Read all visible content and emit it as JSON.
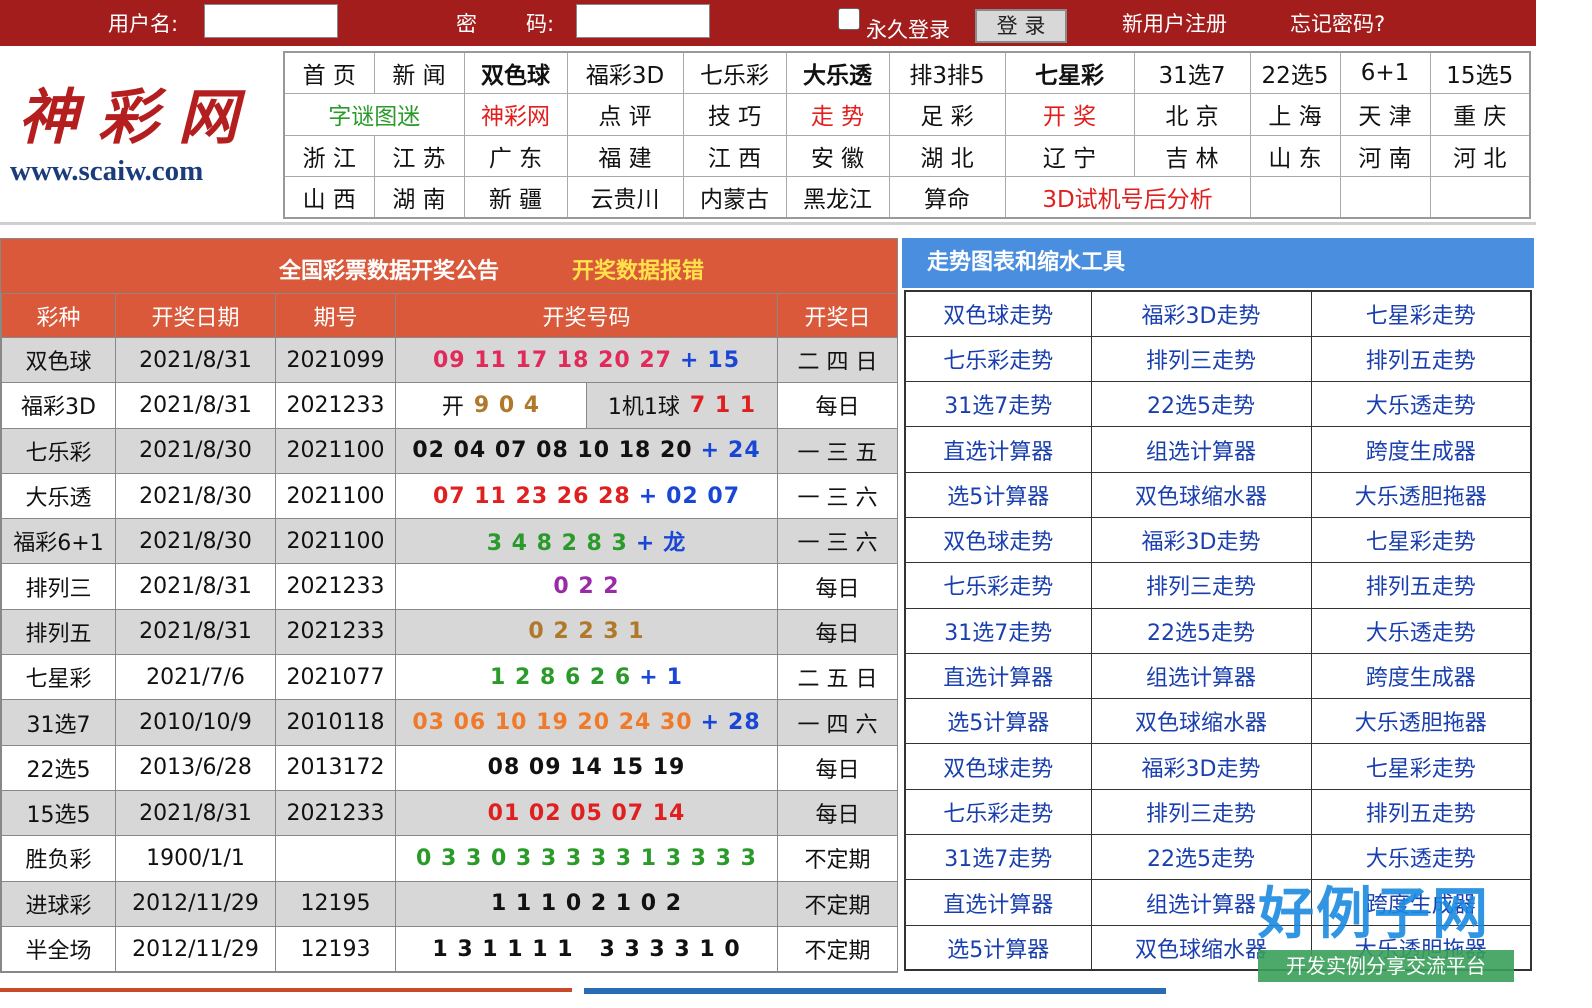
{
  "login": {
    "username_label": "用户名:",
    "password_label_1": "密",
    "password_label_2": "码:",
    "remember_label": "永久登录",
    "login_button": "登 录",
    "register_link": "新用户注册",
    "forgot_link": "忘记密码?"
  },
  "logo": {
    "name": "神彩网",
    "url": "www.scaiw.com"
  },
  "nav": [
    [
      {
        "t": "首 页"
      },
      {
        "t": "新 闻"
      },
      {
        "t": "双色球",
        "s": "b"
      },
      {
        "t": "福彩3D"
      },
      {
        "t": "七乐彩"
      },
      {
        "t": "大乐透",
        "s": "b"
      },
      {
        "t": "排3排5"
      },
      {
        "t": "七星彩",
        "s": "b"
      },
      {
        "t": "31选7"
      },
      {
        "t": "22选5"
      },
      {
        "t": "6+1"
      },
      {
        "t": "15选5"
      }
    ],
    [
      {
        "t": "字谜图迷",
        "s": "g",
        "c": 2
      },
      {
        "t": "神彩网",
        "s": "r"
      },
      {
        "t": "点 评"
      },
      {
        "t": "技 巧"
      },
      {
        "t": "走 势",
        "s": "r"
      },
      {
        "t": "足 彩"
      },
      {
        "t": "开 奖",
        "s": "r"
      },
      {
        "t": "北 京"
      },
      {
        "t": "上 海"
      },
      {
        "t": "天 津"
      },
      {
        "t": "重 庆"
      }
    ],
    [
      {
        "t": "浙 江"
      },
      {
        "t": "江 苏"
      },
      {
        "t": "广 东"
      },
      {
        "t": "福 建"
      },
      {
        "t": "江 西"
      },
      {
        "t": "安 徽"
      },
      {
        "t": "湖 北"
      },
      {
        "t": "辽 宁"
      },
      {
        "t": "吉 林"
      },
      {
        "t": "山 东"
      },
      {
        "t": "河 南"
      },
      {
        "t": "河 北"
      }
    ],
    [
      {
        "t": "山 西"
      },
      {
        "t": "湖 南"
      },
      {
        "t": "新 疆"
      },
      {
        "t": "云贵川"
      },
      {
        "t": "内蒙古"
      },
      {
        "t": "黑龙江"
      },
      {
        "t": "算命"
      },
      {
        "t": "3D试机号后分析",
        "s": "r",
        "c": 2
      },
      {
        "t": ""
      },
      {
        "t": ""
      },
      {
        "t": ""
      }
    ]
  ],
  "results": {
    "title": "全国彩票数据开奖公告",
    "report": "开奖数据报错",
    "headers": [
      "彩种",
      "开奖日期",
      "期号",
      "开奖号码",
      "开奖日"
    ],
    "rows": [
      {
        "name": "双色球",
        "date": "2021/8/31",
        "issue": "2021099",
        "main": "09 11 17 18 20 27",
        "mc": "pink",
        "extra": "15",
        "day": "二 四 日"
      },
      {
        "name": "福彩3D",
        "date": "2021/8/31",
        "issue": "2021233",
        "split": true,
        "a_label": "开",
        "a_num": "9 0 4",
        "b_label": "1机1球",
        "b_num": "7 1 1",
        "day": "每日"
      },
      {
        "name": "七乐彩",
        "date": "2021/8/30",
        "issue": "2021100",
        "main": "02 04 07 08 10 18 20",
        "mc": "black",
        "extra": "24",
        "day": "一 三 五"
      },
      {
        "name": "大乐透",
        "date": "2021/8/30",
        "issue": "2021100",
        "main": "07 11 23 26 28",
        "mc": "red",
        "extra": "02 07",
        "day": "一 三 六"
      },
      {
        "name": "福彩6+1",
        "date": "2021/8/30",
        "issue": "2021100",
        "main": "3 4 8 2 8 3",
        "mc": "green",
        "extra": "龙",
        "day": "一 三 六"
      },
      {
        "name": "排列三",
        "date": "2021/8/31",
        "issue": "2021233",
        "main": "0 2 2",
        "mc": "purple",
        "day": "每日"
      },
      {
        "name": "排列五",
        "date": "2021/8/31",
        "issue": "2021233",
        "main": "0 2 2 3 1",
        "mc": "brown",
        "day": "每日"
      },
      {
        "name": "七星彩",
        "date": "2021/7/6",
        "issue": "2021077",
        "main": "1 2 8 6 2 6",
        "mc": "green",
        "extra": "1",
        "day": "二 五 日"
      },
      {
        "name": "31选7",
        "date": "2010/10/9",
        "issue": "2010118",
        "main": "03 06 10 19 20 24 30",
        "mc": "orange",
        "extra": "28",
        "day": "一 四 六"
      },
      {
        "name": "22选5",
        "date": "2013/6/28",
        "issue": "2013172",
        "main": "08 09 14 15 19",
        "mc": "black",
        "day": "每日"
      },
      {
        "name": "15选5",
        "date": "2021/8/31",
        "issue": "2021233",
        "main": "01 02 05 07 14",
        "mc": "red",
        "day": "每日"
      },
      {
        "name": "胜负彩",
        "date": "1900/1/1",
        "issue": "",
        "main": "0 3 3 0 3 3 3 3 3 1 3 3 3 3",
        "mc": "green",
        "day": "不定期"
      },
      {
        "name": "进球彩",
        "date": "2012/11/29",
        "issue": "12195",
        "main": "1 1 1 0 2 1 0 2",
        "mc": "black",
        "day": "不定期"
      },
      {
        "name": "半全场",
        "date": "2012/11/29",
        "issue": "12193",
        "main": "1 3 1 1 1 1   3 3 3 3 1 0",
        "mc": "black",
        "day": "不定期"
      }
    ]
  },
  "tools": {
    "title": "走势图表和缩水工具",
    "rows": [
      [
        "双色球走势",
        "福彩3D走势",
        "七星彩走势"
      ],
      [
        "七乐彩走势",
        "排列三走势",
        "排列五走势"
      ],
      [
        "31选7走势",
        "22选5走势",
        "大乐透走势"
      ],
      [
        "直选计算器",
        "组选计算器",
        "跨度生成器"
      ],
      [
        "选5计算器",
        "双色球缩水器",
        "大乐透胆拖器"
      ],
      [
        "双色球走势",
        "福彩3D走势",
        "七星彩走势"
      ],
      [
        "七乐彩走势",
        "排列三走势",
        "排列五走势"
      ],
      [
        "31选7走势",
        "22选5走势",
        "大乐透走势"
      ],
      [
        "直选计算器",
        "组选计算器",
        "跨度生成器"
      ],
      [
        "选5计算器",
        "双色球缩水器",
        "大乐透胆拖器"
      ],
      [
        "双色球走势",
        "福彩3D走势",
        "七星彩走势"
      ],
      [
        "七乐彩走势",
        "排列三走势",
        "排列五走势"
      ],
      [
        "31选7走势",
        "22选5走势",
        "大乐透走势"
      ],
      [
        "直选计算器",
        "组选计算器",
        "跨度生成器"
      ],
      [
        "选5计算器",
        "双色球缩水器",
        "大乐透胆拖器"
      ]
    ]
  },
  "watermark": {
    "big": "好例子网",
    "small": "开发实例分享交流平台"
  }
}
